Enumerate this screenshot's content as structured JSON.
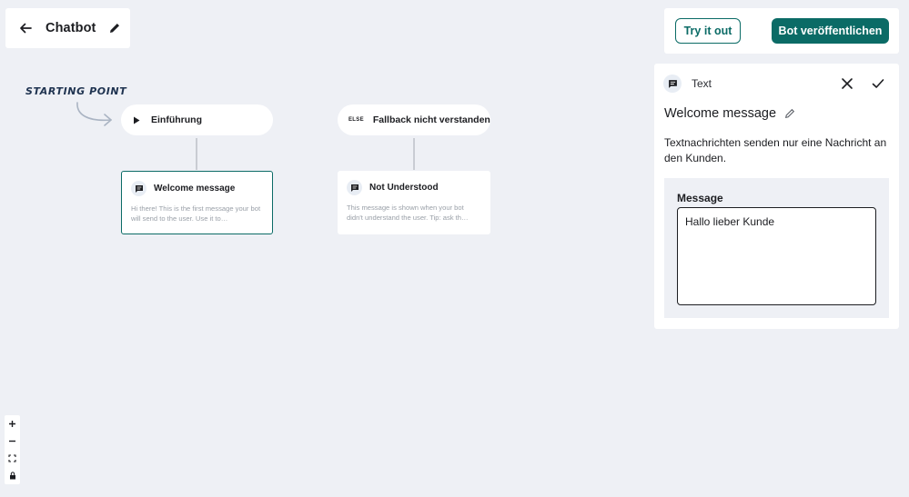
{
  "header": {
    "title": "Chatbot"
  },
  "actions": {
    "try_label": "Try it out",
    "publish_label": "Bot veröffentlichen"
  },
  "canvas": {
    "starting_point_label": "STARTING POINT",
    "intro_node_label": "Einführung",
    "fallback_else_tag": "ELSE",
    "fallback_node_label": "Fallback nicht verstanden",
    "welcome_node": {
      "title": "Welcome message",
      "preview": "Hi there! This is the first message your bot will send to the user. Use it to…"
    },
    "not_understood_node": {
      "title": "Not Understood",
      "preview": "This message is shown when your bot didn't understand the user. Tip: ask th…"
    }
  },
  "panel": {
    "type_label": "Text",
    "title": "Welcome message",
    "description": "Textnachrichten senden nur eine Nachricht an den Kunden.",
    "message_label": "Message",
    "message_value": "Hallo lieber Kunde"
  },
  "colors": {
    "accent": "#0b6b66",
    "canvas_bg": "#eef0f5"
  },
  "icons": [
    "back-arrow-icon",
    "pencil-icon",
    "play-icon",
    "chat-bubble-icon",
    "close-icon",
    "check-icon",
    "zoom-in-icon",
    "zoom-out-icon",
    "fit-view-icon",
    "lock-icon"
  ]
}
